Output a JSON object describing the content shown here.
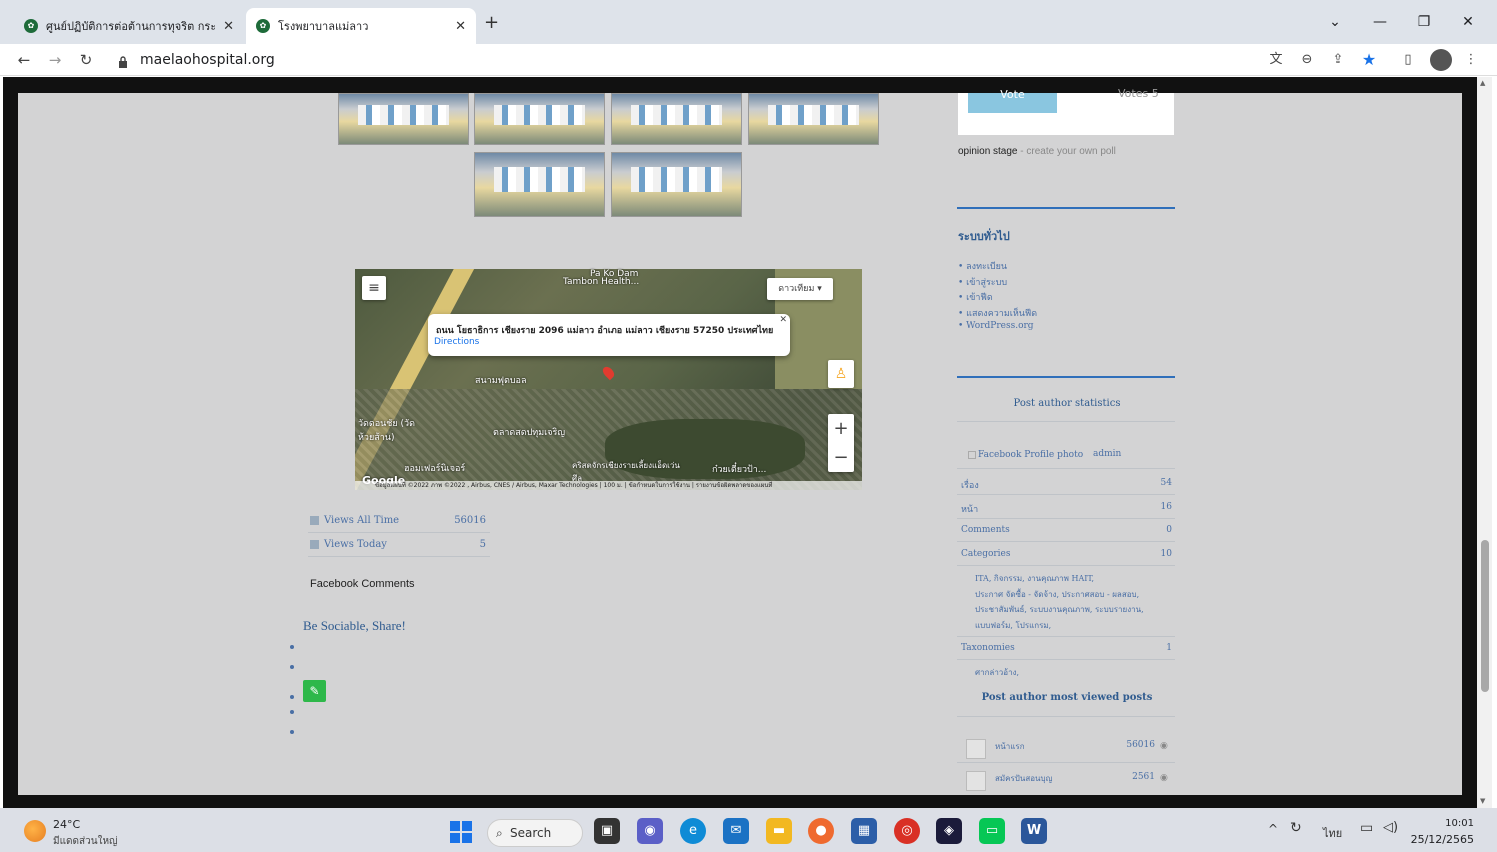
{
  "browser": {
    "tabs": [
      {
        "title": "ศูนย์ปฏิบัติการต่อต้านการทุจริต กระทรวง"
      },
      {
        "title": "โรงพยาบาลแม่ลาว"
      }
    ],
    "new_tab": "+",
    "url": "maelaohospital.org"
  },
  "map": {
    "map_type": "ดาวเทียม",
    "popup_address": "ถนน โยธาธิการ เชียงราย 2096 แม่ลาว อำเภอ แม่ลาว เชียงราย 57250 ประเทศไทย",
    "popup_link": "Directions",
    "labels": [
      "Pa Ko Dam",
      "Tambon Health...",
      "สนามฟุตบอล",
      "วัดดอนชัย (วัดห้วยส้าน)",
      "ตลาดสดปทุมเจริญ",
      "ฮอมเฟอร์นิเจอร์",
      "คริสตจักรเชียงรายเลี้ยงแอ็ดเว่น ศึล",
      "ก๋วยเตี๋ยวป้า...",
      "Google"
    ],
    "attribution": "ข้อมูลแผนที่ ©2022 ภาพ ©2022 , Airbus, CNES / Airbus, Maxar Technologies | 100 ม. | ข้อกำหนดในการใช้งาน | รายงานข้อผิดพลาดของแผนที่"
  },
  "views": {
    "all_time_label": "Views All Time",
    "all_time_value": "56016",
    "today_label": "Views Today",
    "today_value": "5"
  },
  "facebook_comments": "Facebook Comments",
  "sociable": "Be Sociable, Share!",
  "poll": {
    "vote_button": "Vote",
    "votes_text": "Votes 5",
    "credit_brand": "opinion stage",
    "credit_text": " - create your own poll"
  },
  "sidebar": {
    "general_title": "ระบบทั่วไป",
    "general_links": [
      "ลงทะเบียน",
      "เข้าสู่ระบบ",
      "เข้าฟีด",
      "แสดงความเห็นฟีด",
      "WordPress.org"
    ],
    "author_stats_title": "Post author statistics",
    "profile_alt": "Facebook Profile photo",
    "author": "admin",
    "stats": [
      {
        "label": "เรื่อง",
        "value": "54"
      },
      {
        "label": "หน้า",
        "value": "16"
      },
      {
        "label": "Comments",
        "value": "0"
      },
      {
        "label": "Categories",
        "value": "10"
      }
    ],
    "categories_text": [
      "ITA, กิจกรรม, งานคุณภาพ HAIT,",
      "ประกาศ จัดซื้อ - จัดจ้าง, ประกาศสอบ - ผลสอบ,",
      "ประชาสัมพันธ์, ระบบงานคุณภาพ, ระบบรายงาน,",
      "แบบฟอร์ม, โปรแกรม,"
    ],
    "taxonomies_label": "Taxonomies",
    "taxonomies_value": "1",
    "taxonomies_text": "ศากล่าวอ้าง,",
    "most_viewed_title": "Post author most viewed posts",
    "most_viewed": [
      {
        "title": "หน้าแรก",
        "views": "56016"
      },
      {
        "title": "สมัครปันสอนบุญ",
        "views": "2561"
      }
    ]
  },
  "taskbar": {
    "weather_temp": "24°C",
    "weather_desc": "มีแดดส่วนใหญ่",
    "search_label": "Search",
    "lang": "ไทย",
    "time": "10:01",
    "date": "25/12/2565"
  }
}
